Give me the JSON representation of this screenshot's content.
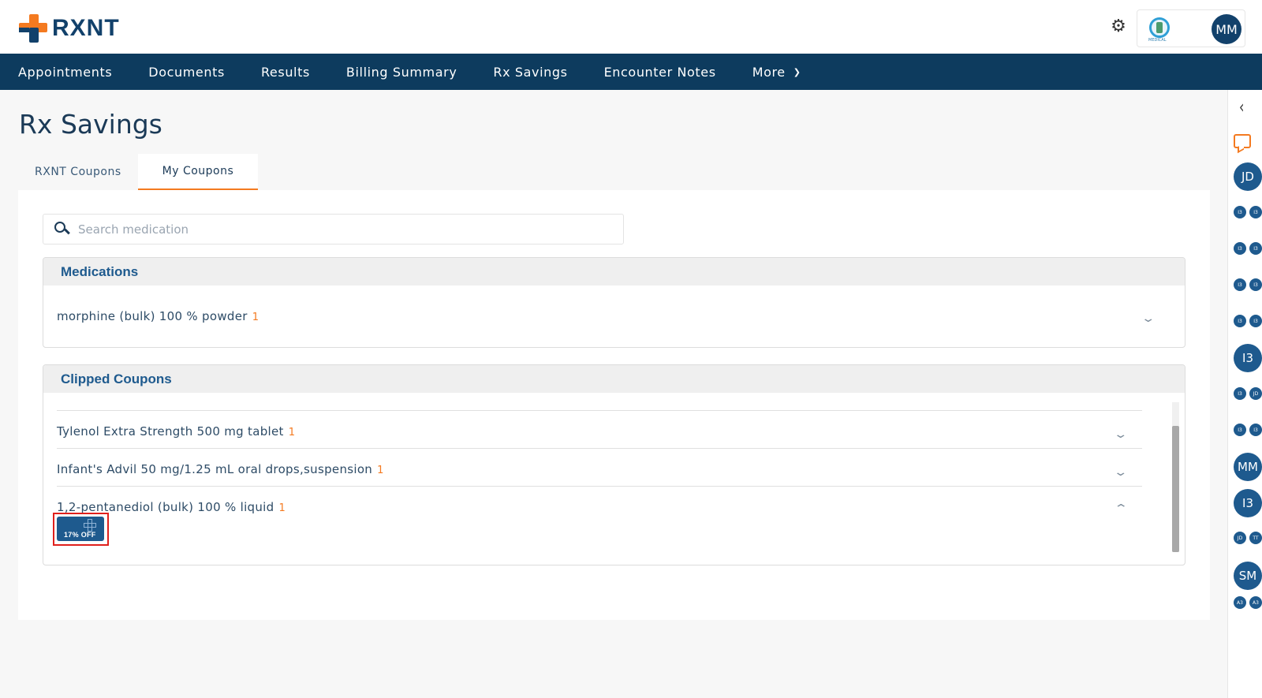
{
  "brand": {
    "name": "RXNT"
  },
  "header": {
    "practice_logo_caption": "MEDICAL",
    "user_initials": "MM"
  },
  "nav": {
    "items": [
      "Appointments",
      "Documents",
      "Results",
      "Billing Summary",
      "Rx Savings",
      "Encounter Notes"
    ],
    "more_label": "More"
  },
  "page": {
    "title": "Rx Savings"
  },
  "tabs": [
    {
      "label": "RXNT Coupons",
      "active": false
    },
    {
      "label": "My Coupons",
      "active": true
    }
  ],
  "search": {
    "placeholder": "Search medication",
    "value": ""
  },
  "medications": {
    "title": "Medications",
    "items": [
      {
        "name": "morphine (bulk) 100 % powder",
        "count": "1"
      }
    ]
  },
  "clipped_coupons": {
    "title": "Clipped Coupons",
    "items": [
      {
        "name": "Tylenol Extra Strength 500 mg tablet",
        "count": "1",
        "expanded": false
      },
      {
        "name": "Infant's Advil 50 mg/1.25 mL oral drops,suspension",
        "count": "1",
        "expanded": false
      },
      {
        "name": "1,2-pentanediol (bulk) 100 % liquid",
        "count": "1",
        "expanded": true
      }
    ],
    "coupon_badge": "17% OFF"
  },
  "right_rail": {
    "avatars": [
      "JD",
      "I3",
      "MM",
      "I3",
      "SM"
    ],
    "mini_pairs": [
      [
        "I3",
        "I3"
      ],
      [
        "I3",
        "I3"
      ],
      [
        "I3",
        "I3"
      ],
      [
        "I3",
        "I3"
      ],
      [
        "I3",
        "JD"
      ],
      [
        "I3",
        "I3"
      ],
      [
        "JD",
        "TT"
      ],
      [
        "A3",
        "A3"
      ]
    ]
  },
  "colors": {
    "navy": "#0d3b5e",
    "accent": "#f47a20",
    "link_blue": "#1e5a8e",
    "highlight": "#e0201c"
  }
}
